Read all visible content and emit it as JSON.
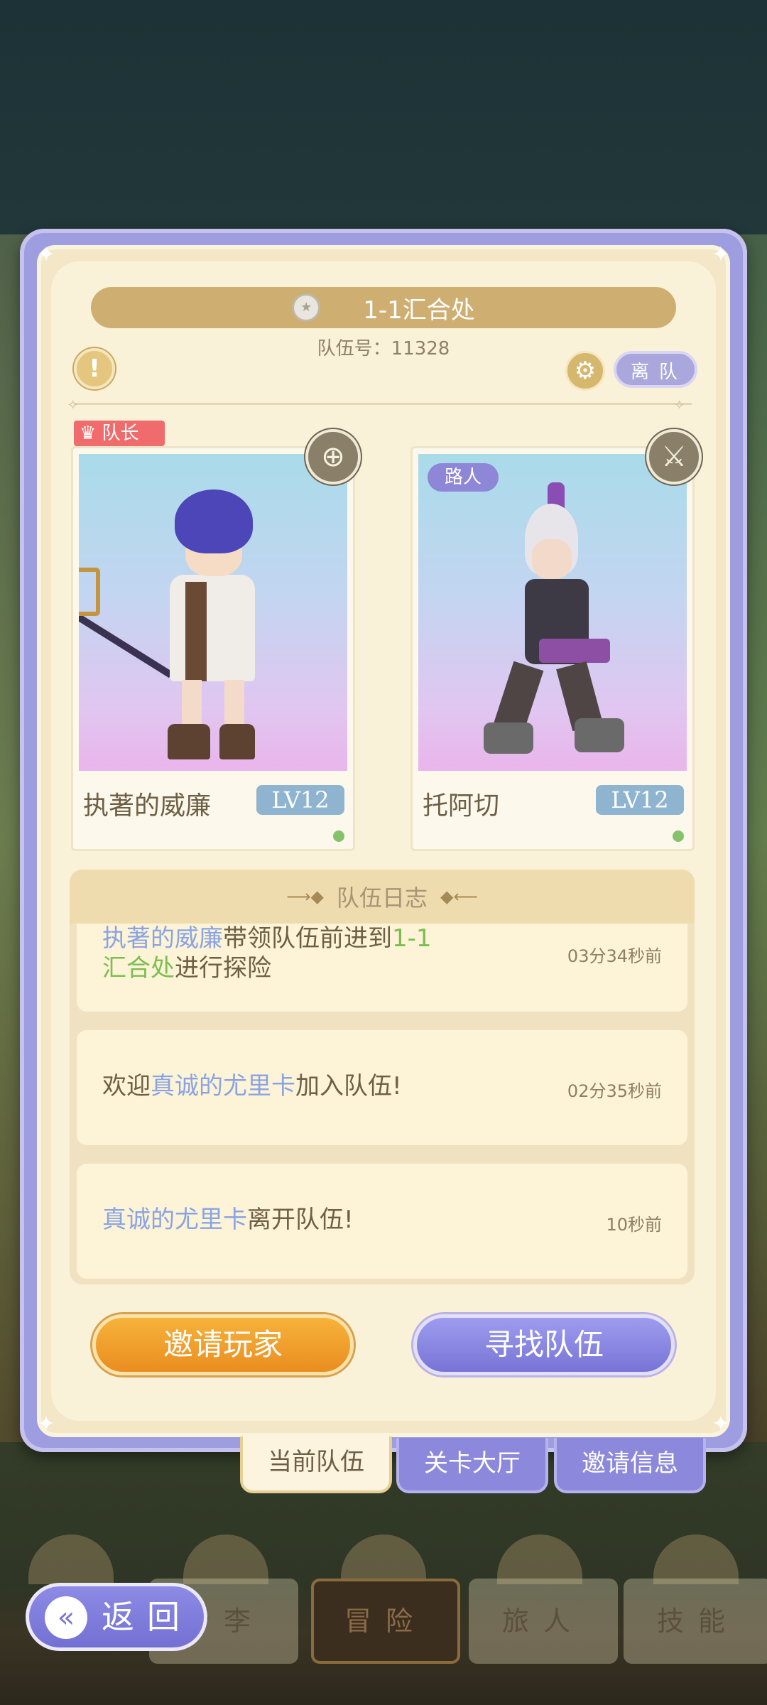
{
  "panel": {
    "title": "1-1汇合处",
    "team_number": "队伍号：11328",
    "leave_button": "离队"
  },
  "members": [
    {
      "tag": "队长",
      "name": "执著的威廉",
      "level": "LV12"
    },
    {
      "tag": "路人",
      "name": "托阿切",
      "level": "LV12"
    }
  ],
  "log": {
    "title": "队伍日志",
    "entries": [
      {
        "parts": [
          "执著的威廉",
          "带领队伍前进到",
          "1-1",
          "汇合处",
          "进行探险"
        ],
        "time": "03分34秒前"
      },
      {
        "parts": [
          "欢迎",
          "真诚的尤里卡",
          "加入队伍!"
        ],
        "time": "02分35秒前"
      },
      {
        "parts": [
          "真诚的尤里卡",
          "离开队伍!"
        ],
        "time": "10秒前"
      }
    ]
  },
  "actions": {
    "invite": "邀请玩家",
    "find": "寻找队伍"
  },
  "tabs": [
    "当前队伍",
    "关卡大厅",
    "邀请信息"
  ],
  "nav": {
    "back": "返回",
    "items": [
      "行李",
      "冒险",
      "旅人",
      "技能"
    ]
  },
  "icons": {
    "alert": "exclamation-icon",
    "settings": "gear-icon",
    "leader": "crown-icon",
    "role1": "crosshair-emblem-icon",
    "role2": "sword-emblem-icon"
  },
  "colors": {
    "accent_gold": "#cfae71",
    "accent_purple": "#8c88dc",
    "invite_orange": "#ea8d21",
    "name_blue": "#8aa4e3",
    "place_green": "#7dbd52"
  }
}
